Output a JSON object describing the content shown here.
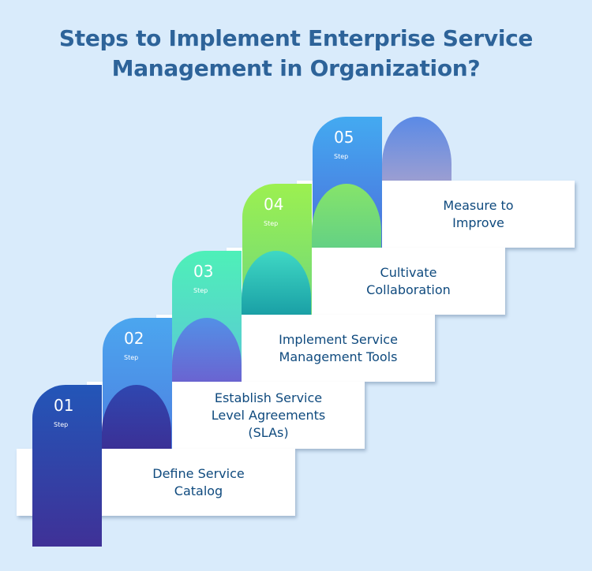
{
  "title": {
    "line1": "Steps to Implement Enterprise Service",
    "line2": "Management in Organization?"
  },
  "step_label": "Step",
  "steps": [
    {
      "number": "01",
      "label": "Step",
      "text_lines": [
        "Define Service",
        "Catalog"
      ],
      "colors": {
        "front_top": "#2356b8",
        "front_bottom": "#3f3197",
        "arch_top": "#2f47b0",
        "arch_bottom": "#3b3096"
      }
    },
    {
      "number": "02",
      "label": "Step",
      "text_lines": [
        "Establish Service",
        "Level Agreements",
        "(SLAs)"
      ],
      "colors": {
        "front_top": "#4ba6ef",
        "front_bottom": "#4e7fe0",
        "arch_top": "#5390e6",
        "arch_bottom": "#6a64d1"
      }
    },
    {
      "number": "03",
      "label": "Step",
      "text_lines": [
        "Implement Service",
        "Management Tools"
      ],
      "colors": {
        "front_top": "#4ef0b8",
        "front_bottom": "#5bc6d6",
        "arch_top": "#3fd8c4",
        "arch_bottom": "#1aa0a6"
      }
    },
    {
      "number": "04",
      "label": "Step",
      "text_lines": [
        "Cultivate",
        "Collaboration"
      ],
      "colors": {
        "front_top": "#9cf050",
        "front_bottom": "#6fd87c",
        "arch_top": "#86e46a",
        "arch_bottom": "#64d184"
      }
    },
    {
      "number": "05",
      "label": "Step",
      "text_lines": [
        "Measure to",
        "Improve"
      ],
      "colors": {
        "front_top": "#43aaf1",
        "front_bottom": "#4d6fdb",
        "arch_top": "#5a8ae6",
        "arch_bottom": "#9b9ed2"
      }
    }
  ]
}
